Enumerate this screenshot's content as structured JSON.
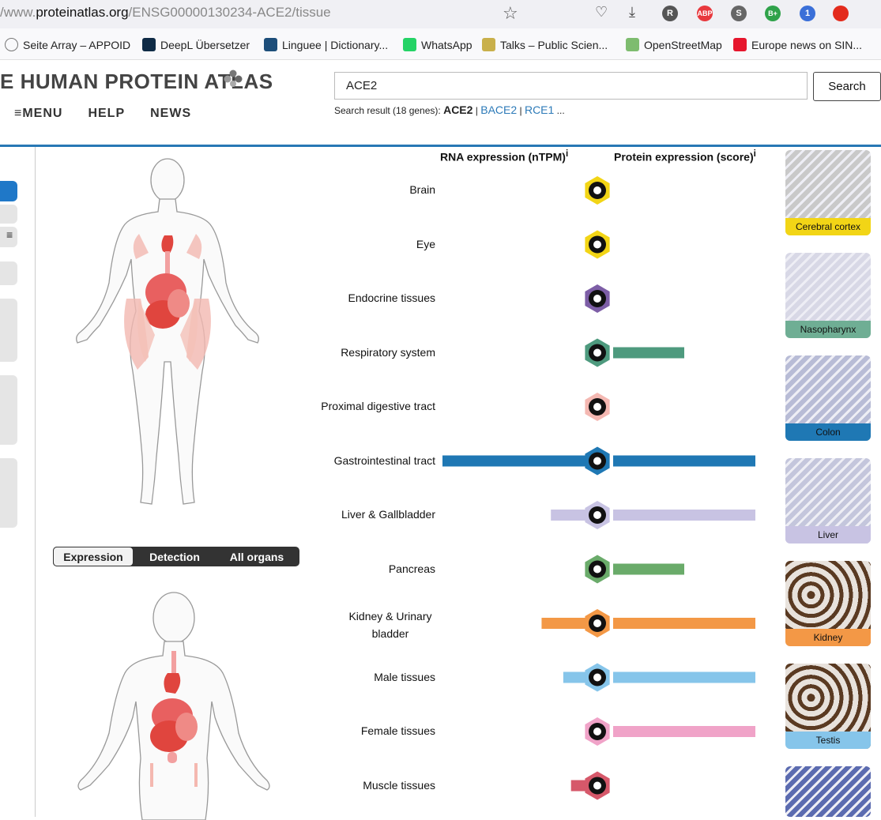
{
  "browser": {
    "url_prefix": "/www.",
    "url_domain": "proteinatlas.org",
    "url_path": "/ENSG00000130234-ACE2/tissue",
    "bookmarks": [
      {
        "label": "Seite Array – APPOID",
        "color": "#777"
      },
      {
        "label": "DeepL Übersetzer",
        "color": "#0f2b46"
      },
      {
        "label": "Linguee | Dictionary...",
        "color": "#1d4e7a"
      },
      {
        "label": "WhatsApp",
        "color": "#25d366"
      },
      {
        "label": "Talks – Public Scien...",
        "color": "#c9b04b"
      },
      {
        "label": "OpenStreetMap",
        "color": "#7ebc6f"
      },
      {
        "label": "Europe news on SIN...",
        "color": "#e6162d"
      }
    ],
    "extensions": [
      {
        "label": "R",
        "color": "#555"
      },
      {
        "label": "ABP",
        "color": "#e8383d"
      },
      {
        "label": "S",
        "color": "#666"
      },
      {
        "label": "B+",
        "color": "#2fa24a"
      },
      {
        "label": "1",
        "color": "#3a6fd8"
      },
      {
        "label": "",
        "color": "#e32b1c"
      }
    ]
  },
  "site": {
    "logo": "E HUMAN PROTEIN ATLAS",
    "nav": [
      "MENU",
      "HELP",
      "NEWS"
    ],
    "search_value": "ACE2",
    "search_button": "Search",
    "result_prefix": "Search result (18 genes): ",
    "result_first": "ACE2",
    "result_links": [
      "BACE2",
      "RCE1"
    ],
    "result_suffix": " ..."
  },
  "toggle": [
    "Expression",
    "Detection",
    "All organs"
  ],
  "chart_data": {
    "type": "bar",
    "headers": {
      "rna": "RNA expression (nTPM)",
      "protein": "Protein expression (score)"
    },
    "categories": [
      "Brain",
      "Eye",
      "Endocrine tissues",
      "Respiratory system",
      "Proximal digestive tract",
      "Gastrointestinal tract",
      "Liver & Gallbladder",
      "Pancreas",
      "Kidney & Urinary bladder",
      "Male tissues",
      "Female tissues",
      "Muscle tissues"
    ],
    "colors": [
      "#f2d516",
      "#f2d516",
      "#7d5ea6",
      "#4e9a7e",
      "#f4b8b2",
      "#1f78b4",
      "#c8c3e3",
      "#6aab6a",
      "#f39846",
      "#86c5ea",
      "#f0a3c8",
      "#d6586a"
    ],
    "rna_values": [
      5,
      4,
      6,
      4,
      5,
      100,
      30,
      5,
      36,
      22,
      6,
      17
    ],
    "protein_values": [
      0,
      0,
      0,
      1,
      0,
      2,
      2,
      1,
      2,
      2,
      2,
      0
    ],
    "protein_max": 2
  },
  "thumbnails": [
    {
      "caption": "Cerebral cortex",
      "color": "#f2d516"
    },
    {
      "caption": "Nasopharynx",
      "color": "#6fae94"
    },
    {
      "caption": "Colon",
      "color": "#1f78b4"
    },
    {
      "caption": "Liver",
      "color": "#c8c3e3"
    },
    {
      "caption": "Kidney",
      "color": "#f39846"
    },
    {
      "caption": "Testis",
      "color": "#86c5ea"
    },
    {
      "caption": "",
      "color": "#5b6bb0"
    }
  ]
}
